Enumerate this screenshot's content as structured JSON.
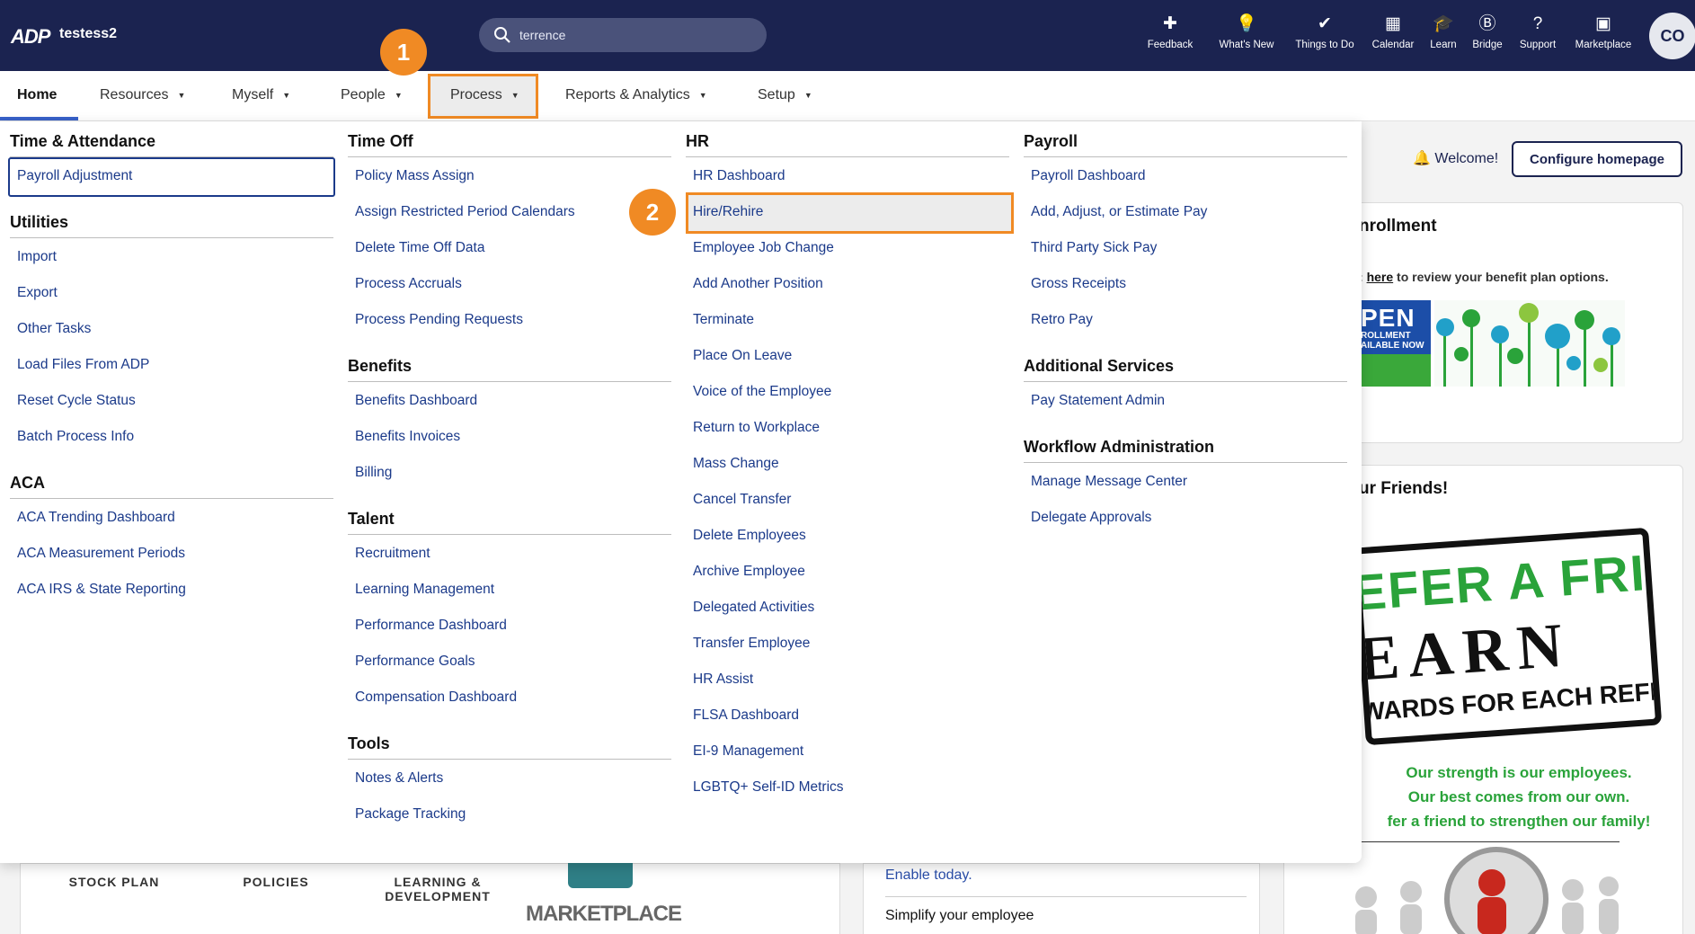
{
  "topbar": {
    "logo": "ADP",
    "tenant": "testess2",
    "search_value": "terrence",
    "tools": [
      {
        "label": "Feedback",
        "icon": "feedback-icon",
        "glyph": "✚"
      },
      {
        "label": "What's New",
        "icon": "lightbulb-icon",
        "glyph": "💡"
      },
      {
        "label": "Things to Do",
        "icon": "checklist-icon",
        "glyph": "✔"
      },
      {
        "label": "Calendar",
        "icon": "calendar-icon",
        "glyph": "▦"
      },
      {
        "label": "Learn",
        "icon": "graduation-cap-icon",
        "glyph": "🎓"
      },
      {
        "label": "Bridge",
        "icon": "bridge-icon",
        "glyph": "Ⓑ"
      },
      {
        "label": "Support",
        "icon": "support-chat-icon",
        "glyph": "?"
      },
      {
        "label": "Marketplace",
        "icon": "marketplace-icon",
        "glyph": "▣"
      }
    ],
    "avatar": "CO"
  },
  "nav": {
    "items": [
      "Home",
      "Resources",
      "Myself",
      "People",
      "Process",
      "Reports & Analytics",
      "Setup"
    ],
    "active": "Home",
    "open": "Process"
  },
  "annotations": {
    "step1": "1",
    "step2": "2"
  },
  "menu": {
    "time_attendance": {
      "title": "Time & Attendance",
      "items": [
        "Payroll Adjustment"
      ]
    },
    "utilities": {
      "title": "Utilities",
      "items": [
        "Import",
        "Export",
        "Other Tasks",
        "Load Files From ADP",
        "Reset Cycle Status",
        "Batch Process Info"
      ]
    },
    "aca": {
      "title": "ACA",
      "items": [
        "ACA Trending Dashboard",
        "ACA Measurement Periods",
        "ACA IRS & State Reporting"
      ]
    },
    "time_off": {
      "title": "Time Off",
      "items": [
        "Policy Mass Assign",
        "Assign Restricted Period Calendars",
        "Delete Time Off Data",
        "Process Accruals",
        "Process Pending Requests"
      ]
    },
    "benefits": {
      "title": "Benefits",
      "items": [
        "Benefits Dashboard",
        "Benefits Invoices",
        "Billing"
      ]
    },
    "talent": {
      "title": "Talent",
      "items": [
        "Recruitment",
        "Learning Management",
        "Performance Dashboard",
        "Performance Goals",
        "Compensation Dashboard"
      ]
    },
    "tools": {
      "title": "Tools",
      "items": [
        "Notes & Alerts",
        "Package Tracking"
      ]
    },
    "hr": {
      "title": "HR",
      "items": [
        "HR Dashboard",
        "Hire/Rehire",
        "Employee Job Change",
        "Add Another Position",
        "Terminate",
        "Place On Leave",
        "Voice of the Employee",
        "Return to Workplace",
        "Mass Change",
        "Cancel Transfer",
        "Delete Employees",
        "Archive Employee",
        "Delegated Activities",
        "Transfer Employee",
        "HR Assist",
        "FLSA Dashboard",
        "EI-9 Management",
        "LGBTQ+ Self-ID Metrics"
      ]
    },
    "payroll": {
      "title": "Payroll",
      "items": [
        "Payroll Dashboard",
        "Add, Adjust, or Estimate Pay",
        "Third Party Sick Pay",
        "Gross Receipts",
        "Retro Pay"
      ]
    },
    "additional": {
      "title": "Additional Services",
      "items": [
        "Pay Statement Admin"
      ]
    },
    "workflow": {
      "title": "Workflow Administration",
      "items": [
        "Manage Message Center",
        "Delegate Approvals"
      ]
    }
  },
  "background": {
    "welcome": "Welcome!",
    "configure": "Configure homepage",
    "enrollment_title": "nrollment",
    "enrollment_prefix": ": ",
    "enrollment_link": "here",
    "enrollment_suffix": " to review your benefit plan options.",
    "open_big": "PEN",
    "open_small": "ROLLMENT\nAILABLE NOW",
    "friends_title": "ur Friends!",
    "refer_l1": "EFER A FRIEND",
    "refer_l2": "EARN",
    "refer_l3": "WARDS FOR EACH REFERRAL",
    "green1": "Our strength is our employees.",
    "green2": "Our best comes from our own.",
    "green3": "fer a friend to strengthen our family!",
    "stock": "STOCK PLAN",
    "policies": "POLICIES",
    "learning": "LEARNING &\nDEVELOPMENT",
    "marketplace": "MARKETPLACE",
    "enable": "Enable today.",
    "simplify": "Simplify your employee"
  },
  "colors": {
    "navy": "#1b2350",
    "orange": "#f08a24",
    "link": "#1b3a8a",
    "green": "#2aa33a"
  }
}
